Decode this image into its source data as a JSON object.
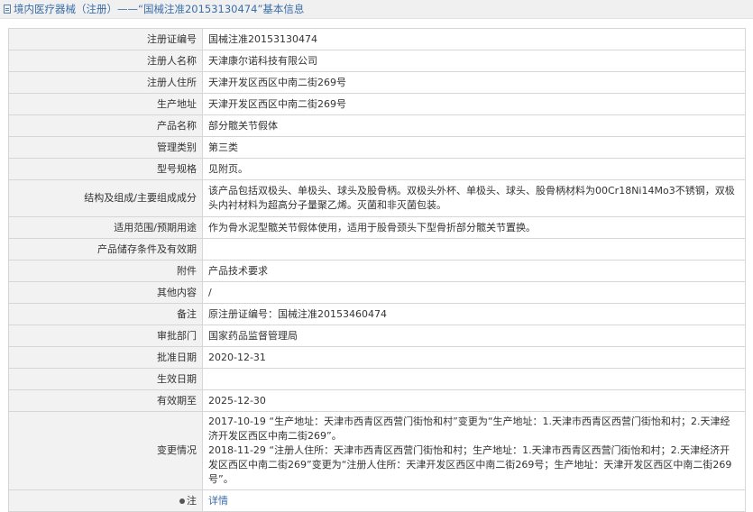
{
  "header": {
    "title": "境内医疗器械（注册）——“国械注准20153130474”基本信息"
  },
  "fields": [
    {
      "label": "注册证编号",
      "value": "国械注准20153130474"
    },
    {
      "label": "注册人名称",
      "value": "天津康尔诺科技有限公司"
    },
    {
      "label": "注册人住所",
      "value": "天津开发区西区中南二街269号"
    },
    {
      "label": "生产地址",
      "value": "天津开发区西区中南二街269号"
    },
    {
      "label": "产品名称",
      "value": "部分髋关节假体"
    },
    {
      "label": "管理类别",
      "value": "第三类"
    },
    {
      "label": "型号规格",
      "value": "见附页。"
    },
    {
      "label": "结构及组成/主要组成成分",
      "value": "该产品包括双极头、单极头、球头及股骨柄。双极头外杯、单极头、球头、股骨柄材料为00Cr18Ni14Mo3不锈钢，双极头内衬材料为超高分子量聚乙烯。灭菌和非灭菌包装。"
    },
    {
      "label": "适用范围/预期用途",
      "value": "作为骨水泥型髋关节假体使用，适用于股骨颈头下型骨折部分髋关节置换。"
    },
    {
      "label": "产品储存条件及有效期",
      "value": ""
    },
    {
      "label": "附件",
      "value": "产品技术要求"
    },
    {
      "label": "其他内容",
      "value": "/"
    },
    {
      "label": "备注",
      "value": "原注册证编号：国械注准20153460474"
    },
    {
      "label": "审批部门",
      "value": "国家药品监督管理局"
    },
    {
      "label": "批准日期",
      "value": "2020-12-31"
    },
    {
      "label": "生效日期",
      "value": ""
    },
    {
      "label": "有效期至",
      "value": "2025-12-30"
    }
  ],
  "changes": {
    "label": "变更情况",
    "entries": [
      "2017-10-19 “生产地址：天津市西青区西营门街怡和村”变更为“生产地址：1.天津市西青区西营门街怡和村；2.天津经济开发区西区中南二街269”。",
      "2018-11-29 “注册人住所：天津市西青区西营门街怡和村；生产地址：1.天津市西青区西营门街怡和村；2.天津经济开发区西区中南二街269”变更为“注册人住所：天津开发区西区中南二街269号；生产地址：天津开发区西区中南二街269号”。"
    ]
  },
  "note": {
    "label": "注",
    "link_text": "详情"
  },
  "colors": {
    "accent": "#3a6ea8",
    "label_bg": "#f2f2f2",
    "border": "#d6d6d6"
  }
}
